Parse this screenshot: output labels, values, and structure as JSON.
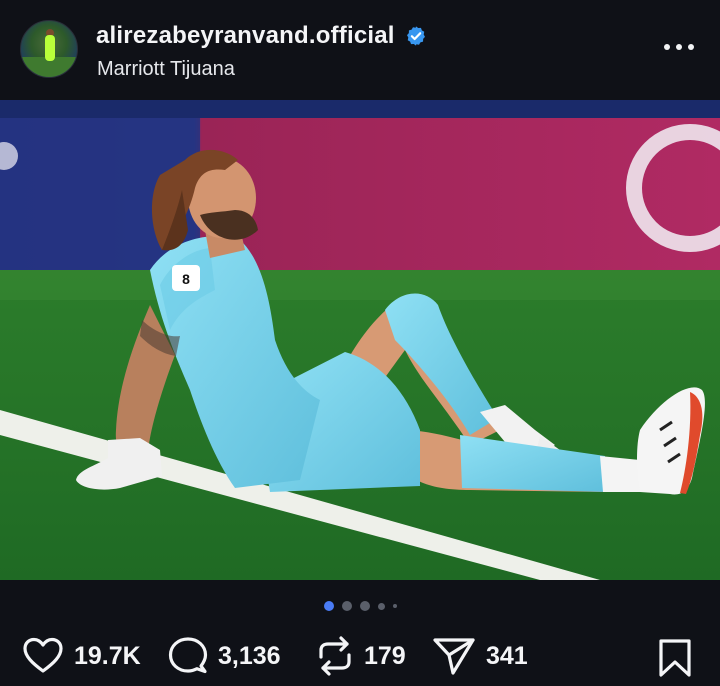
{
  "post": {
    "username": "alirezabeyranvand.official",
    "location": "Marriott Tijuana",
    "verified": true
  },
  "carousel": {
    "total": 5,
    "active_index": 0
  },
  "stats": {
    "likes": "19.7K",
    "comments": "3,136",
    "reposts": "179",
    "shares": "341"
  },
  "colors": {
    "background": "#0f1117",
    "verified_badge": "#3897f0",
    "active_dot": "#4a7cf5",
    "jersey": "#7fd3ec"
  },
  "icons": {
    "like": "heart-icon",
    "comment": "comment-bubble-icon",
    "repost": "repost-icon",
    "share": "send-icon",
    "save": "bookmark-icon",
    "more": "more-options-icon"
  }
}
